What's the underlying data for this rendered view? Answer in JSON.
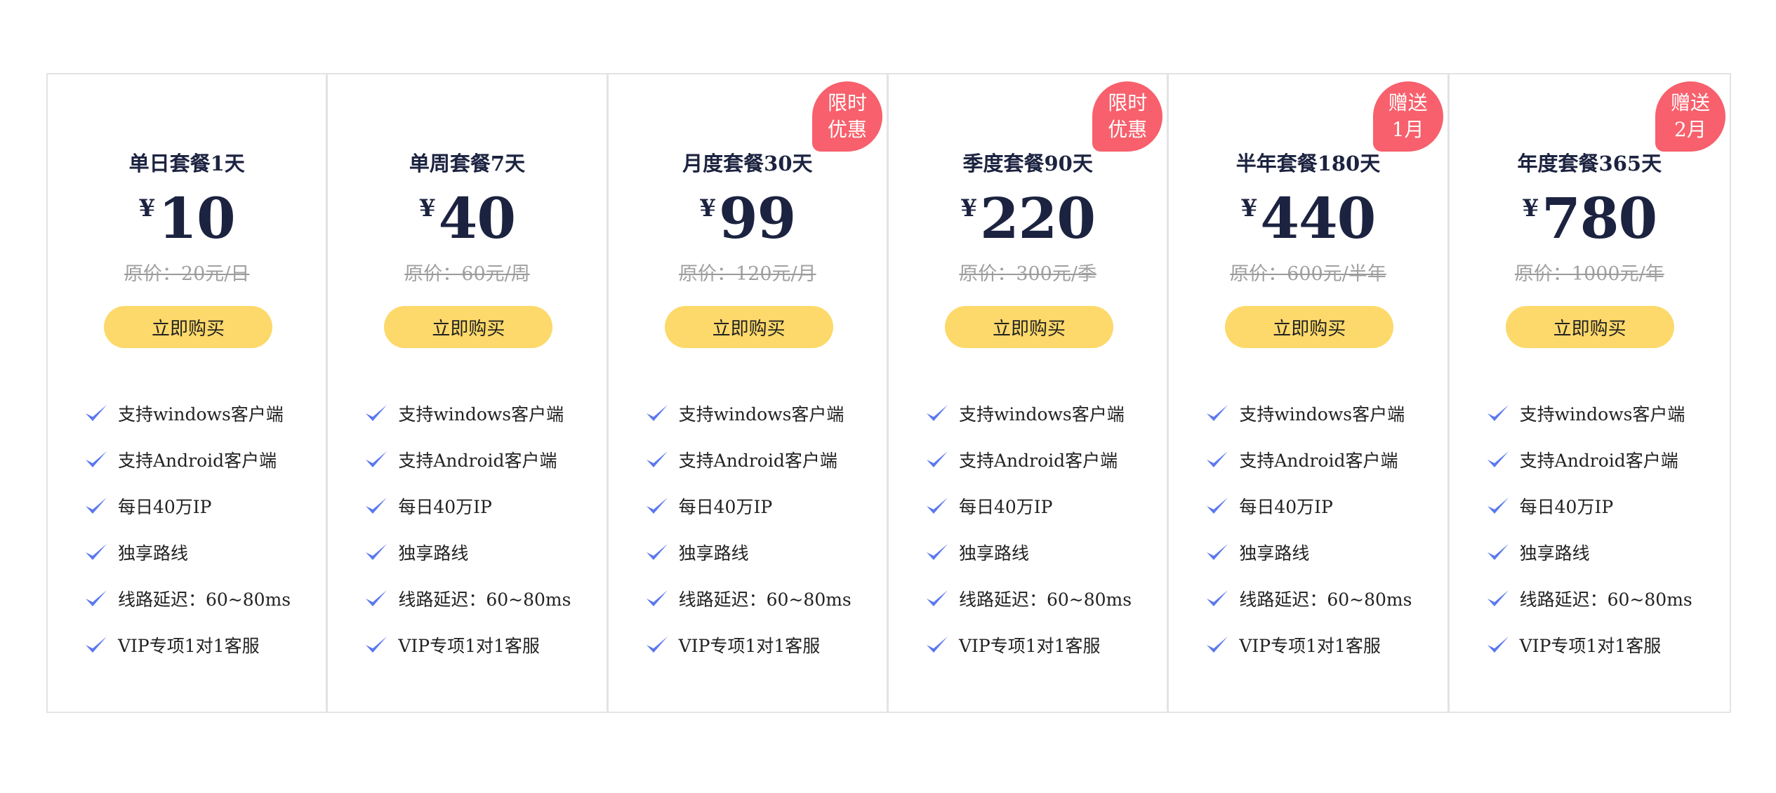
{
  "buy_label": "立即购买",
  "orig_prefix": "原价：",
  "currency_symbol": "¥",
  "accent_colors": {
    "title": "#1c2340",
    "button": "#fcd96a",
    "badge": "#f7606c",
    "check": "#5a78ee"
  },
  "features": [
    "支持windows客户端",
    "支持Android客户端",
    "每日40万IP",
    "独享路线",
    "线路延迟：60~80ms",
    "VIP专项1对1客服"
  ],
  "plans": [
    {
      "title": "单日套餐1天",
      "price": "10",
      "orig": "原价：20元/日",
      "badge": null
    },
    {
      "title": "单周套餐7天",
      "price": "40",
      "orig": "原价：60元/周",
      "badge": null
    },
    {
      "title": "月度套餐30天",
      "price": "99",
      "orig": "原价：120元/月",
      "badge": [
        "限时",
        "优惠"
      ]
    },
    {
      "title": "季度套餐90天",
      "price": "220",
      "orig": "原价：300元/季",
      "badge": [
        "限时",
        "优惠"
      ]
    },
    {
      "title": "半年套餐180天",
      "price": "440",
      "orig": "原价：600元/半年",
      "badge": [
        "赠送",
        "1月"
      ]
    },
    {
      "title": "年度套餐365天",
      "price": "780",
      "orig": "原价：1000元/年",
      "badge": [
        "赠送",
        "2月"
      ]
    }
  ]
}
